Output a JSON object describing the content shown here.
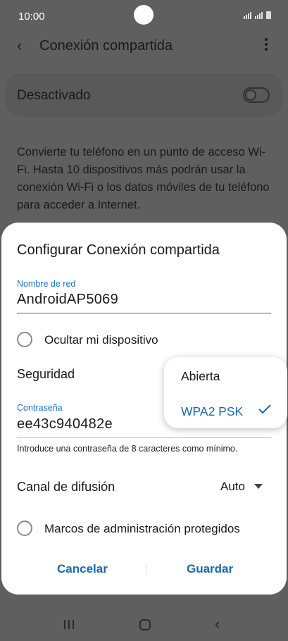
{
  "status_bar": {
    "time": "10:00"
  },
  "app_bar": {
    "title": "Conexión compartida"
  },
  "toggle": {
    "label": "Desactivado",
    "state": "off"
  },
  "description": "Convierte tu teléfono en un punto de acceso Wi-Fi. Hasta 10 dispositivos más podrán usar la conexión Wi-Fi o los datos móviles de tu teléfono para acceder a Internet.",
  "dialog": {
    "title": "Configurar Conexión compartida",
    "network_name": {
      "label": "Nombre de red",
      "value": "AndroidAP5069"
    },
    "hide_device": {
      "label": "Ocultar mi dispositivo",
      "checked": false
    },
    "security": {
      "label": "Seguridad"
    },
    "password": {
      "label": "Contraseña",
      "value": "ee43c940482e",
      "hint": "Introduce una contraseña de 8 caracteres como mínimo."
    },
    "broadcast_channel": {
      "label": "Canal de difusión",
      "value": "Auto"
    },
    "protected_frames": {
      "label": "Marcos de administración protegidos",
      "checked": false
    },
    "buttons": {
      "cancel": "Cancelar",
      "save": "Guardar"
    }
  },
  "security_menu": {
    "options": [
      "Abierta",
      "WPA2 PSK"
    ],
    "selected": "WPA2 PSK"
  },
  "colors": {
    "accent": "#1a73d9",
    "button_text": "#1768b5",
    "scrim_background": "#5f5f5f",
    "dialog_background": "#ffffff"
  },
  "nav_icons": [
    "recents-icon",
    "home-icon",
    "back-icon"
  ]
}
